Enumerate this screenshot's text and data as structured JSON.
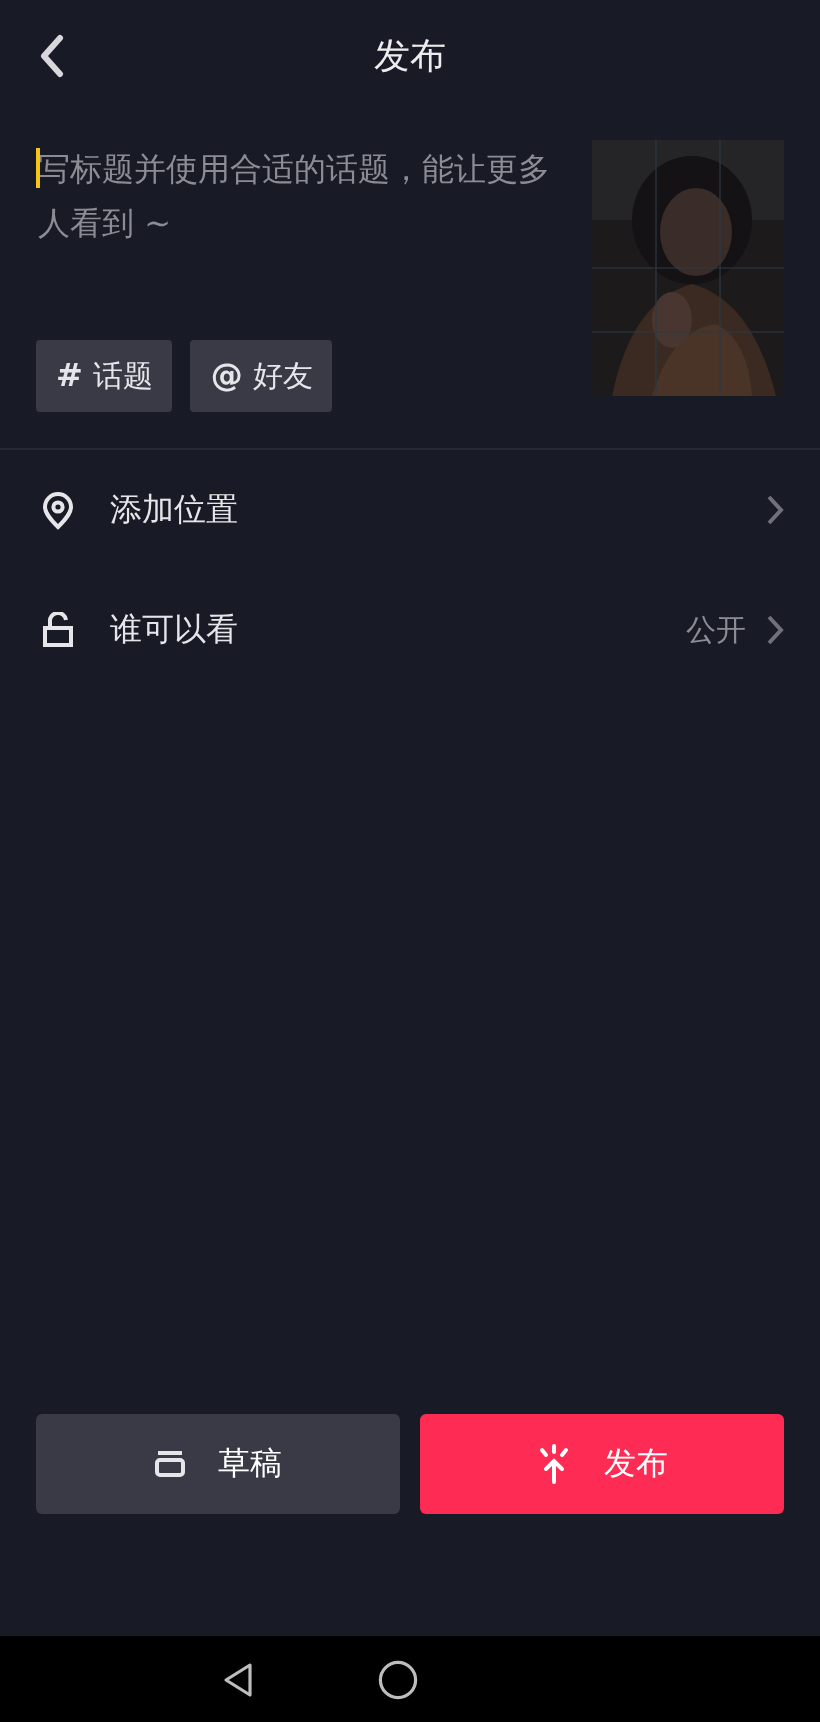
{
  "header": {
    "title": "发布"
  },
  "caption": {
    "placeholder": "写标题并使用合适的话题，能让更多人看到 ~"
  },
  "tags": [
    {
      "symbol": "#",
      "label": "话题"
    },
    {
      "symbol": "@",
      "label": "好友"
    }
  ],
  "options": [
    {
      "label": "添加位置"
    },
    {
      "label": "谁可以看",
      "value": "公开"
    }
  ],
  "actions": [
    {
      "kind": "draft",
      "label": "草稿"
    },
    {
      "kind": "publish",
      "label": "发布"
    }
  ]
}
